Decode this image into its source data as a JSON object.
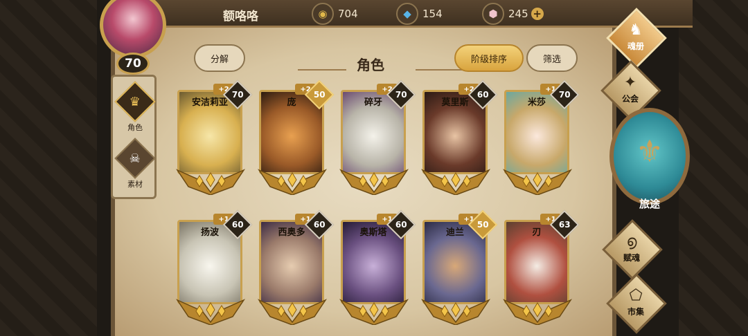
{
  "player": {
    "name": "额咯咯",
    "level": "70"
  },
  "resources": [
    {
      "icon": "gold-coin-icon",
      "glyph": "◉",
      "value": "704"
    },
    {
      "icon": "blue-crystal-icon",
      "glyph": "◆",
      "value": "154"
    },
    {
      "icon": "pink-gem-icon",
      "glyph": "⬢",
      "value": "245"
    }
  ],
  "resource_plus": "+",
  "left_tabs": [
    {
      "label": "角色",
      "icon": "winged-crest-icon",
      "glyph": "♛"
    },
    {
      "label": "素材",
      "icon": "beast-skull-icon",
      "glyph": "☠"
    }
  ],
  "header": {
    "decompose_label": "分解",
    "title": "角色",
    "sort_label": "阶级排序",
    "filter_label": "筛选"
  },
  "cards": [
    {
      "name": "安洁莉亚",
      "plus": "+2",
      "level": "70",
      "level_style": "dark",
      "portrait": [
        "#f6e6a8",
        "#d8b050",
        "#6a5a30"
      ]
    },
    {
      "name": "庞",
      "plus": "+2",
      "level": "50",
      "level_style": "gold",
      "portrait": [
        "#e8a050",
        "#9a5a28",
        "#2a1a10"
      ]
    },
    {
      "name": "碎牙",
      "plus": "+2",
      "level": "70",
      "level_style": "dark",
      "portrait": [
        "#f4f2ea",
        "#b8b4a8",
        "#6a4a70"
      ]
    },
    {
      "name": "莫里斯",
      "plus": "+2",
      "level": "60",
      "level_style": "dark",
      "portrait": [
        "#e8c4a4",
        "#6a3a2a",
        "#2a1a14"
      ]
    },
    {
      "name": "米莎",
      "plus": "+1",
      "level": "70",
      "level_style": "dark",
      "portrait": [
        "#fbe8dc",
        "#c8a86a",
        "#6aa8a0"
      ]
    },
    {
      "name": "扬波",
      "plus": "+1",
      "level": "60",
      "level_style": "dark",
      "portrait": [
        "#f8f6ee",
        "#c8c4b4",
        "#7a7464"
      ]
    },
    {
      "name": "西奥多",
      "plus": "+1",
      "level": "60",
      "level_style": "dark",
      "portrait": [
        "#e6ccb0",
        "#9a7a6a",
        "#3a2a44"
      ]
    },
    {
      "name": "奥斯塔",
      "plus": "+1",
      "level": "60",
      "level_style": "dark",
      "portrait": [
        "#c8b0d8",
        "#6a5080",
        "#241a34"
      ]
    },
    {
      "name": "迪兰",
      "plus": "+1",
      "level": "50",
      "level_style": "gold",
      "portrait": [
        "#d8a878",
        "#6a6890",
        "#2a2a44"
      ]
    },
    {
      "name": "刃",
      "plus": "+1",
      "level": "63",
      "level_style": "dark",
      "portrait": [
        "#f4ece4",
        "#b05040",
        "#5a4030"
      ]
    }
  ],
  "right_nav": [
    {
      "label": "魂册",
      "icon": "soul-book-icon",
      "glyph": "♞"
    },
    {
      "label": "公会",
      "icon": "guild-eagle-icon",
      "glyph": "✦"
    },
    {
      "label": "旅途",
      "icon": "journey-compass-icon",
      "glyph": "⚜"
    },
    {
      "label": "赋魂",
      "icon": "soul-swirl-icon",
      "glyph": "൭"
    },
    {
      "label": "市集",
      "icon": "market-gem-icon",
      "glyph": "⬠"
    }
  ]
}
